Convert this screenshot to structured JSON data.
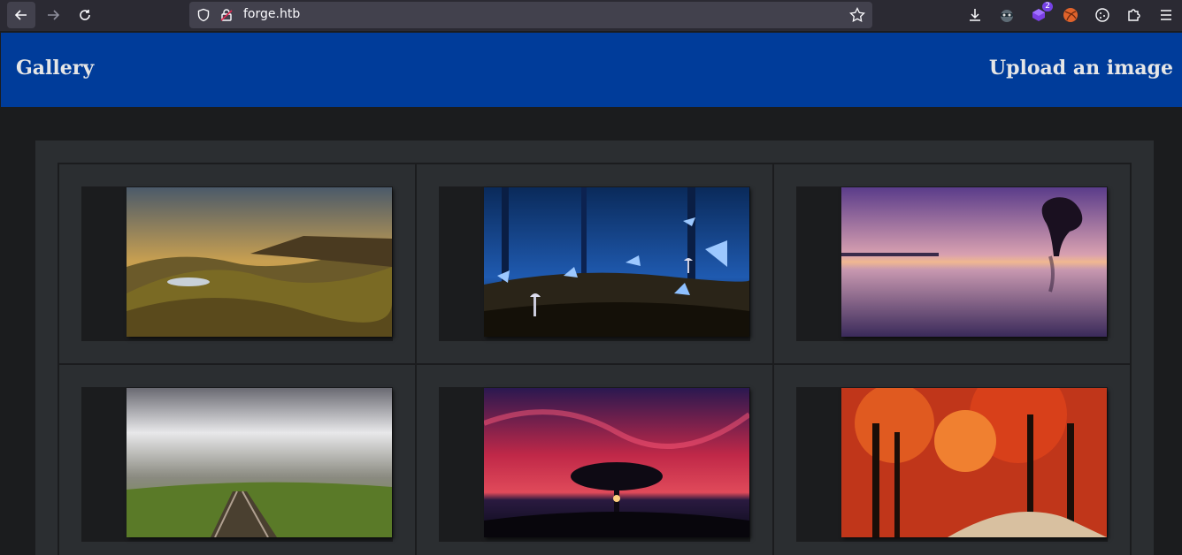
{
  "browser": {
    "url": "forge.htb",
    "extension_badge": "2"
  },
  "site": {
    "brand": "Gallery",
    "upload_link": "Upload an image"
  },
  "images": [
    {
      "icon": "mountain-landscape-photo"
    },
    {
      "icon": "blue-butterflies-mushrooms-photo"
    },
    {
      "icon": "purple-sunset-lake-tree-photo"
    },
    {
      "icon": "railway-tracks-field-photo"
    },
    {
      "icon": "red-sky-tree-silhouette-photo"
    },
    {
      "icon": "autumn-forest-path-photo"
    }
  ],
  "colors": {
    "header": "#003c9a",
    "background": "#1b1c1e",
    "gallery_panel": "#2b2e31"
  }
}
